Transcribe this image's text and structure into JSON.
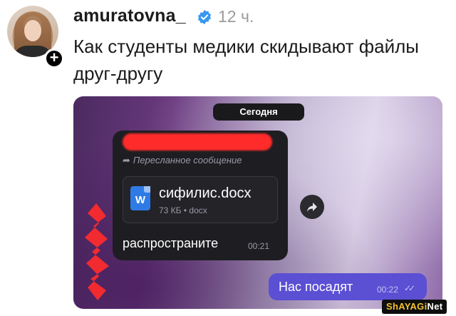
{
  "post": {
    "username": "amuratovna_",
    "time": "12 ч.",
    "text": "Как студенты медики скидывают файлы друг-другу"
  },
  "icons": {
    "verified": "verified-badge-icon",
    "add": "plus-icon",
    "forward": "forward-arrow-icon",
    "share": "share-icon",
    "doc": "word-doc-icon",
    "read": "double-check-icon"
  },
  "chat": {
    "date": "Сегодня",
    "forwarded_label": "Пересланное сообщение",
    "file_name": "сифилис.docx",
    "file_meta": "73 КБ • docx",
    "doc_letter": "W",
    "message": "распространите",
    "message_time": "00:21",
    "reply": "Нас посадят",
    "reply_time": "00:22"
  },
  "watermark": {
    "part1": "ShAYAGi",
    "part2": "Net"
  },
  "colors": {
    "verified": "#3897f0",
    "redaction": "#ff2b2b",
    "reply_bubble": "#5b4fd3",
    "doc_icon": "#2f7be6"
  }
}
